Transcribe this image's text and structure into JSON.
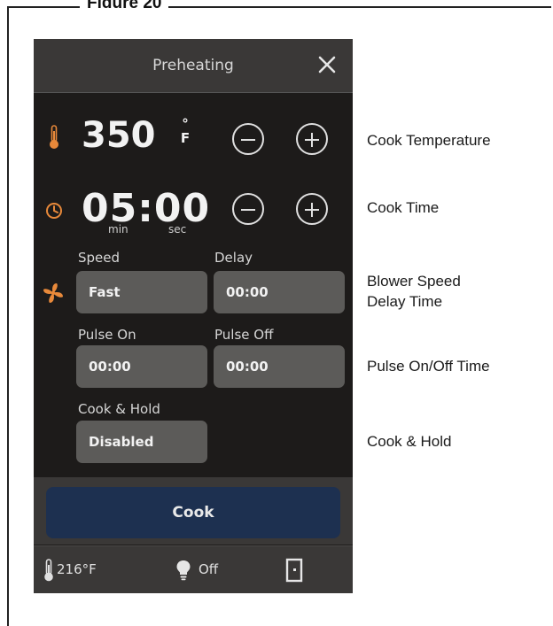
{
  "figure": {
    "title": "Figure 20"
  },
  "screen": {
    "title": "Preheating",
    "temperature": {
      "value": "350",
      "unit_degree": "°",
      "unit_letter": "F"
    },
    "time": {
      "value": "05:00",
      "min_label": "min",
      "sec_label": "sec"
    },
    "fields": {
      "speed": {
        "label": "Speed",
        "value": "Fast"
      },
      "delay": {
        "label": "Delay",
        "value": "00:00"
      },
      "pulse_on": {
        "label": "Pulse On",
        "value": "00:00"
      },
      "pulse_off": {
        "label": "Pulse Off",
        "value": "00:00"
      },
      "cook_hold": {
        "label": "Cook & Hold",
        "value": "Disabled"
      }
    },
    "cook_button": "Cook",
    "status": {
      "oven_temp": "216°F",
      "light": "Off"
    }
  },
  "callouts": {
    "cook_temperature": "Cook Temperature",
    "cook_time": "Cook Time",
    "blower_speed": "Blower Speed",
    "delay_time": "Delay Time",
    "pulse": "Pulse On/Off Time",
    "cook_hold": "Cook & Hold"
  },
  "colors": {
    "screen_bg": "#1d1b1a",
    "bar_bg": "#3a3837",
    "field_bg": "#5c5b59",
    "cook_button_bg": "#1d3050",
    "accent_orange": "#e8893a"
  },
  "icons": [
    "thermometer-icon",
    "clock-icon",
    "fan-icon",
    "close-icon",
    "minus-icon",
    "plus-icon",
    "lightbulb-icon",
    "door-icon"
  ]
}
